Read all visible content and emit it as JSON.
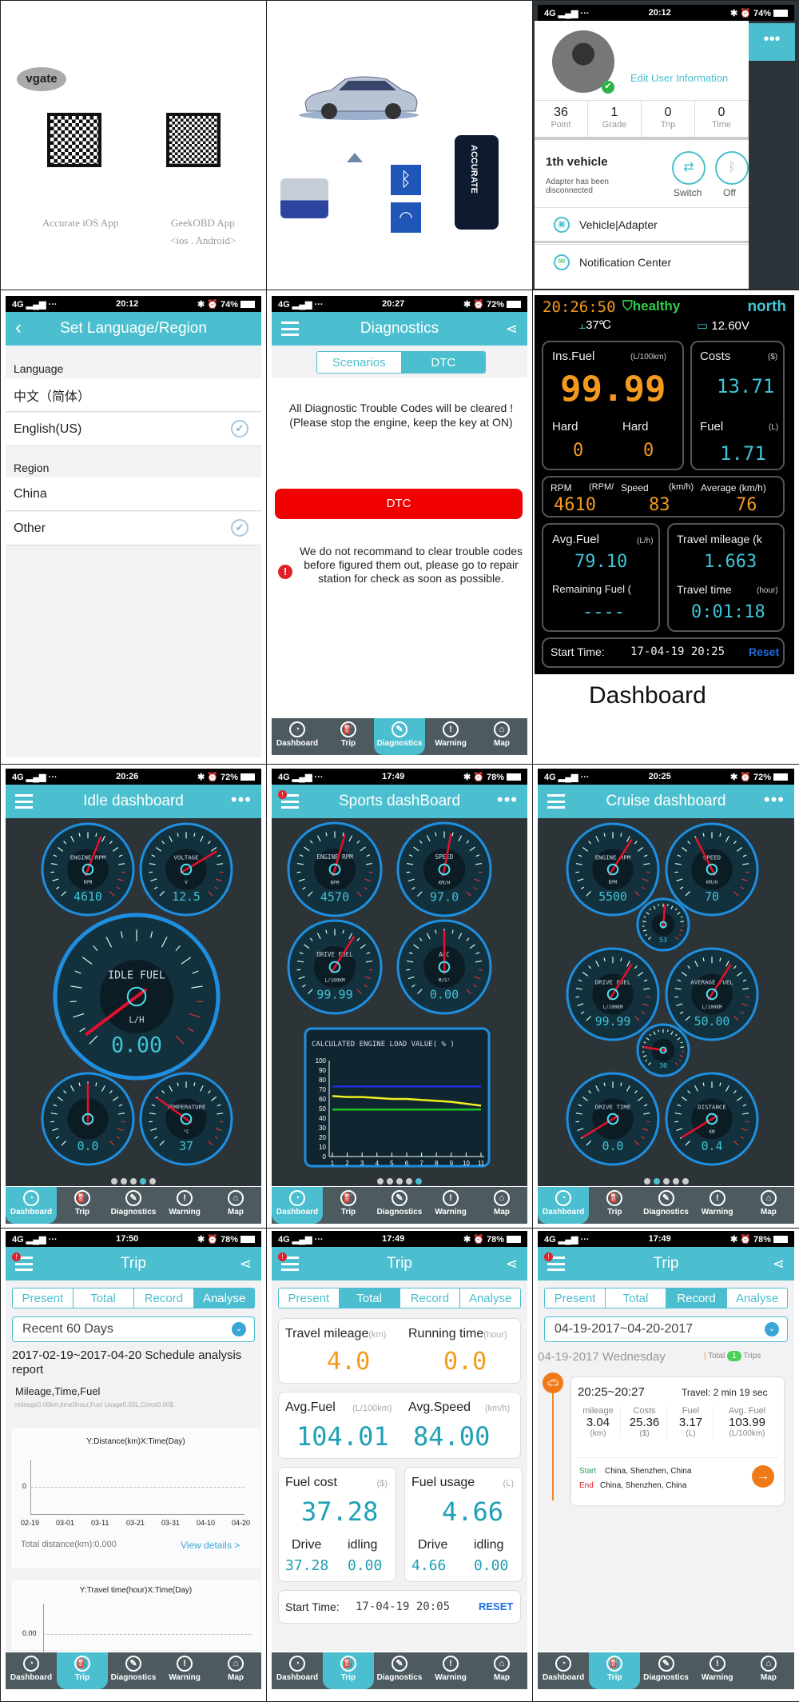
{
  "colors": {
    "teal": "#4bbfcf",
    "nav": "#4d5b60",
    "orange": "#f39a1e",
    "cyan": "#3fc4d6",
    "red": "#f00000"
  },
  "nav_labels": [
    "Dashboard",
    "Trip",
    "Diagnostics",
    "Warning",
    "Map"
  ],
  "panel_qr": {
    "logo": "vgate",
    "qr1_label": "Accurate iOS App",
    "qr2_label": "GeekOBD  App",
    "qr2_sub": "<ios . Android>"
  },
  "panel_device": {
    "phone_brand": "ACCURATE",
    "icons": [
      "bluetooth-icon",
      "wifi-icon"
    ]
  },
  "panel_profile": {
    "status": {
      "carrier": "4G",
      "time": "20:12",
      "battery": "74%"
    },
    "more": "•••",
    "edit_link": "Edit User Information",
    "stats": [
      {
        "value": "36",
        "label": "Point"
      },
      {
        "value": "1",
        "label": "Grade"
      },
      {
        "value": "0",
        "label": "Trip"
      },
      {
        "value": "0",
        "label": "Time"
      }
    ],
    "vehicle_title": "1th vehicle",
    "vehicle_status": "Adapter has been disconnected",
    "switch_label": "Switch",
    "off_label": "Off",
    "menu": [
      "Vehicle|Adapter",
      "Notification Center"
    ]
  },
  "panel_language": {
    "status": {
      "carrier": "4G",
      "time": "20:12",
      "battery": "74%"
    },
    "title": "Set Language/Region",
    "language_header": "Language",
    "languages": [
      {
        "label": "中文（简体）",
        "checked": false
      },
      {
        "label": "English(US)",
        "checked": true
      }
    ],
    "region_header": "Region",
    "regions": [
      {
        "label": "China",
        "checked": false
      },
      {
        "label": "Other",
        "checked": true
      }
    ]
  },
  "panel_diag": {
    "status": {
      "carrier": "4G",
      "time": "20:27",
      "battery": "72%"
    },
    "title": "Diagnostics",
    "tabs": [
      "Scenarios",
      "DTC"
    ],
    "active_tab": 1,
    "message_1": "All Diagnostic Trouble Codes will be cleared !",
    "message_2": "(Please stop the engine, keep the key at ON)",
    "button": "DTC",
    "warning": "We do not recommand to clear trouble codes before figured them out, please go to repair station for check as soon as possible.",
    "nav_active": 2
  },
  "panel_dash": {
    "clock": "20:26:50",
    "health": "healthy",
    "heading": "north",
    "coolant": "37℃",
    "voltage": "12.60V",
    "ins_fuel": {
      "label": "Ins.Fuel",
      "unit": "(L/100km)",
      "value": "99.99"
    },
    "hard_1": {
      "label": "Hard",
      "value": "0"
    },
    "hard_2": {
      "label": "Hard",
      "value": "0"
    },
    "costs": {
      "label": "Costs",
      "unit": "($)",
      "value": "13.71"
    },
    "fuel": {
      "label": "Fuel",
      "unit": "(L)",
      "value": "1.71"
    },
    "rpm": {
      "label": "RPM",
      "unit": "(RPM/",
      "value": "4610"
    },
    "speed": {
      "label": "Speed",
      "unit": "(km/h)",
      "value": "83"
    },
    "average": {
      "label": "Average (km/h)",
      "value": "76"
    },
    "avg_fuel": {
      "label": "Avg.Fuel",
      "unit": "(L/h)",
      "value": "79.10"
    },
    "remaining": {
      "label": "Remaining Fuel (",
      "value": "----"
    },
    "mileage": {
      "label": "Travel mileage (k",
      "value": "1.663"
    },
    "travel_time": {
      "label": "Travel time",
      "unit": "(hour)",
      "value": "0:01:18"
    },
    "start_label": "Start Time:",
    "start_value": "17-04-19 20:25",
    "reset": "Reset",
    "caption": "Dashboard"
  },
  "panel_idle": {
    "status": {
      "carrier": "4G",
      "time": "20:26",
      "battery": "72%"
    },
    "title": "Idle dashboard",
    "more": "•••",
    "page_count": 5,
    "page_active": 3,
    "nav_active": 0,
    "gauges": [
      {
        "label": "ENGINE RPM",
        "unit": "RPM",
        "value": "4610",
        "needle": 0.58
      },
      {
        "label": "VOLTAGE",
        "unit": "V",
        "value": "12.5",
        "needle": 0.72
      },
      {
        "label": "IDLE FUEL",
        "unit": "L/H",
        "value": "0.00",
        "needle": 0.03
      },
      {
        "label": "",
        "unit": "",
        "value": "0.0",
        "needle": 0.5
      },
      {
        "label": "TEMPERATURE",
        "unit": "°C",
        "value": "37",
        "needle": 0.3
      }
    ]
  },
  "panel_sports": {
    "status": {
      "carrier": "4G",
      "time": "17:49",
      "battery": "78%"
    },
    "title": "Sports dashBoard",
    "more": "•••",
    "page_count": 5,
    "page_active": 4,
    "nav_active": 0,
    "gauges": [
      {
        "label": "ENGINE RPM",
        "unit": "RPM",
        "value": "4570",
        "needle": 0.56
      },
      {
        "label": "SPEED",
        "unit": "KM/H",
        "value": "97.0",
        "needle": 0.54
      },
      {
        "label": "DRIVE FUEL",
        "unit": "L/100KM",
        "value": "99.99",
        "needle": 0.62
      },
      {
        "label": "ACC",
        "unit": "M/S²",
        "value": "0.00",
        "needle": 0.5
      }
    ],
    "chart_data": {
      "type": "line",
      "title": "CALCULATED ENGINE LOAD VALUE( % )",
      "x": [
        1,
        2,
        3,
        4,
        5,
        6,
        7,
        8,
        9,
        10,
        11
      ],
      "ylim": [
        0,
        100
      ],
      "yticks": [
        0,
        10,
        20,
        30,
        40,
        50,
        60,
        70,
        80,
        90,
        100
      ],
      "series": [
        {
          "color": "#1c2fd8",
          "values": [
            73,
            73,
            73,
            73,
            73,
            73,
            73,
            73,
            73,
            73,
            73
          ]
        },
        {
          "color": "#f0f020",
          "values": [
            63,
            62,
            62,
            61,
            60,
            60,
            59,
            58,
            57,
            55,
            53
          ]
        },
        {
          "color": "#22c022",
          "values": [
            49,
            49,
            49,
            49,
            49,
            49,
            49,
            49,
            49,
            49,
            49
          ]
        }
      ],
      "grid": false
    }
  },
  "panel_cruise": {
    "status": {
      "carrier": "4G",
      "time": "20:25",
      "battery": "72%"
    },
    "title": "Cruise dashboard",
    "more": "•••",
    "page_count": 5,
    "page_active": 1,
    "nav_active": 0,
    "gauges": [
      {
        "label": "ENGINE RPM",
        "unit": "RPM",
        "value": "5500",
        "needle": 0.62
      },
      {
        "label": "SPEED",
        "unit": "KM/H",
        "value": "70",
        "needle": 0.4
      },
      {
        "label": "",
        "unit": "",
        "value": "53",
        "needle": 0.52
      },
      {
        "label": "DRIVE FUEL",
        "unit": "L/100KM",
        "value": "99.99",
        "needle": 0.62
      },
      {
        "label": "AVERAGE FUEL",
        "unit": "L/100KM",
        "value": "50.00",
        "needle": 0.62
      },
      {
        "label": "",
        "unit": "",
        "value": "30",
        "needle": 0.2
      },
      {
        "label": "DRIVE TIME",
        "unit": "",
        "value": "0.0",
        "needle": 0.05
      },
      {
        "label": "DISTANCE",
        "unit": "KM",
        "value": "0.4",
        "needle": 0.05
      }
    ]
  },
  "trip_title": "Trip",
  "trip_tabs": [
    "Present",
    "Total",
    "Record",
    "Analyse"
  ],
  "panel_analyse": {
    "status": {
      "carrier": "4G",
      "time": "17:50",
      "battery": "78%"
    },
    "range": "Recent 60 Days",
    "report_title": "2017-02-19~2017-04-20 Schedule analysis report",
    "section": "Mileage,Time,Fuel",
    "summary": "mileage0.00km,time0hour,Fuel Usage0.00L,Const0.00$.",
    "chart1": {
      "title": "Y:Distance(km)X:Time(Day)",
      "ytick": "0",
      "xticks": [
        "02-19",
        "03-01",
        "03-11",
        "03-21",
        "03-31",
        "04-10",
        "04-20"
      ],
      "total": "Total distance(km):0.000",
      "link": "View details >"
    },
    "chart2": {
      "title": "Y:Travel time(hour)X:Time(Day)",
      "ytick": "0.00"
    }
  },
  "panel_total": {
    "status": {
      "carrier": "4G",
      "time": "17:49",
      "battery": "78%"
    },
    "mileage": {
      "label": "Travel mileage",
      "unit": "(km)",
      "value": "4.0"
    },
    "running": {
      "label": "Running time",
      "unit": "(hour)",
      "value": "0.0"
    },
    "avg_fuel": {
      "label": "Avg.Fuel",
      "unit": "(L/100km)",
      "value": "104.01"
    },
    "avg_speed": {
      "label": "Avg.Speed",
      "unit": "(km/h)",
      "value": "84.00"
    },
    "fuel_cost": {
      "label": "Fuel cost",
      "unit": "($)",
      "value": "37.28",
      "drive_label": "Drive",
      "drive": "37.28",
      "idle_label": "idling",
      "idle": "0.00"
    },
    "fuel_usage": {
      "label": "Fuel usage",
      "unit": "(L)",
      "value": "4.66",
      "drive_label": "Drive",
      "drive": "4.66",
      "idle_label": "idling",
      "idle": "0.00"
    },
    "start_label": "Start Time:",
    "start_value": "17-04-19 20:05",
    "reset": "RESET"
  },
  "panel_record": {
    "status": {
      "carrier": "4G",
      "time": "17:49",
      "battery": "78%"
    },
    "range": "04-19-2017~04-20-2017",
    "day": "04-19-2017 Wednesday",
    "total_label": "Total",
    "total_count": "1",
    "trips_label": "Trips",
    "time_span": "20:25~20:27",
    "travel": "Travel: 2 min 19 sec",
    "metrics": [
      {
        "label": "mileage",
        "value": "3.04",
        "unit": "(km)"
      },
      {
        "label": "Costs",
        "value": "25.36",
        "unit": "($)"
      },
      {
        "label": "Fuel",
        "value": "3.17",
        "unit": "(L)"
      },
      {
        "label": "Avg. Fuel",
        "value": "103.99",
        "unit": "(L/100km)"
      }
    ],
    "start_label": "Start",
    "start": "China, Shenzhen, China",
    "end_label": "End",
    "end": "China, Shenzhen, China"
  }
}
